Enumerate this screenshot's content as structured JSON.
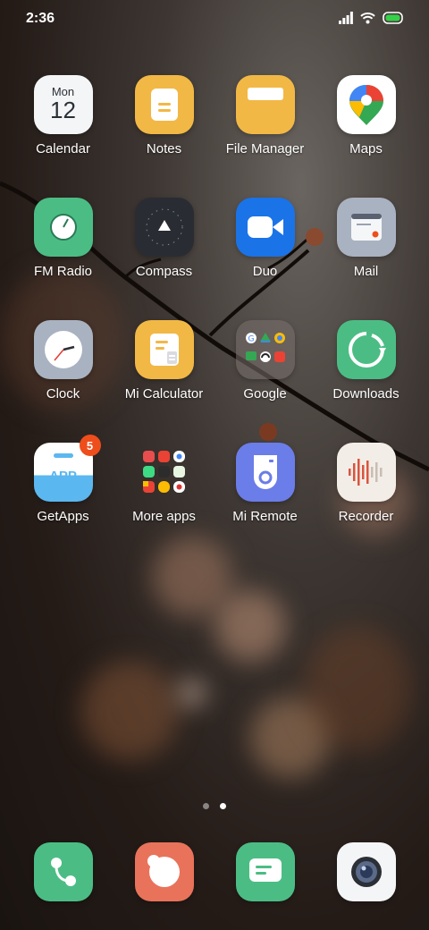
{
  "status_bar": {
    "time": "2:36"
  },
  "apps": [
    {
      "label": "Calendar",
      "day": "Mon",
      "date": "12"
    },
    {
      "label": "Notes"
    },
    {
      "label": "File Manager"
    },
    {
      "label": "Maps"
    },
    {
      "label": "FM Radio"
    },
    {
      "label": "Compass"
    },
    {
      "label": "Duo"
    },
    {
      "label": "Mail"
    },
    {
      "label": "Clock"
    },
    {
      "label": "Mi Calculator"
    },
    {
      "label": "Google"
    },
    {
      "label": "Downloads"
    },
    {
      "label": "GetApps",
      "badge": "5",
      "icon_text": "APP"
    },
    {
      "label": "More apps"
    },
    {
      "label": "Mi Remote"
    },
    {
      "label": "Recorder"
    }
  ],
  "pages": {
    "count": 2,
    "current": 2
  },
  "dock": [
    {
      "name": "phone"
    },
    {
      "name": "messaging"
    },
    {
      "name": "messages"
    },
    {
      "name": "camera"
    }
  ],
  "colors": {
    "notes": "#f2b845",
    "fm_radio": "#4bbd84",
    "compass": "#2a2c33",
    "duo": "#1b73e8",
    "mail": "#a9b2c0",
    "downloads": "#4bbd84",
    "mi_remote": "#6b7de8",
    "badge": "#ee4d1c"
  }
}
